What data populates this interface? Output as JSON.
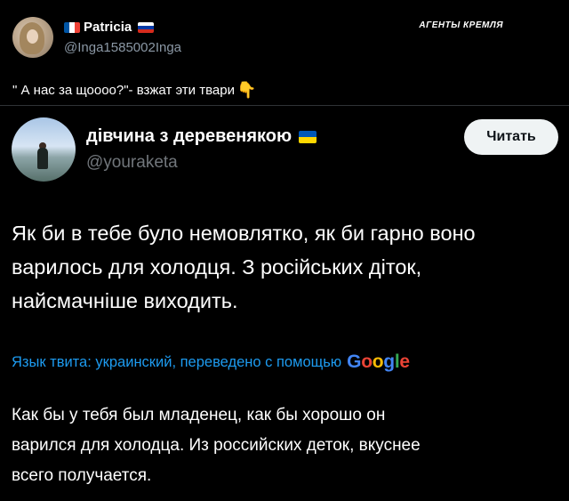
{
  "top_post": {
    "name": "Patricia",
    "handle": "@Inga1585002Inga",
    "text": "\" А нас за щоооо?\"- взжат эти твари",
    "emoji_icon": "backhand-index-pointing-down-icon"
  },
  "watermark": "АГЕНТЫ КРЕМЛЯ",
  "quoted_tweet": {
    "name": "дівчина з деревенякою",
    "handle": "@youraketa",
    "follow_button": "Читать",
    "text": "Як би в тебе було немовлятко, як би гарно воно\nварилось для холодця. З російських діток,\nнайсмачніше виходить.",
    "translation_label": "Язык твита: украинский, переведено с помощью",
    "translation_provider": "Google",
    "translated_text": "Как бы у тебя был младенец, как бы хорошо он\nварился для холодца. Из российских деток, вкуснее\nвсего получается."
  },
  "colors": {
    "background": "#000000",
    "link_blue": "#1d9bf0",
    "muted_text": "#71767b"
  }
}
